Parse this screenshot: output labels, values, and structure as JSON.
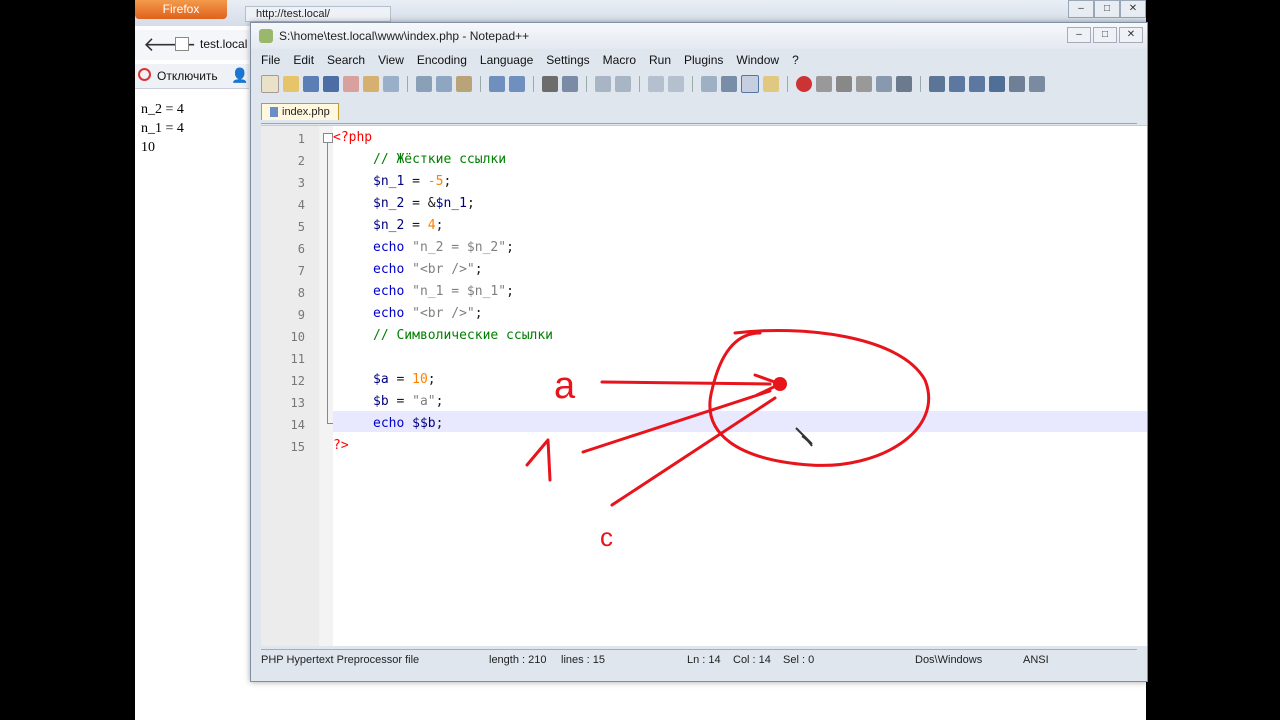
{
  "firefox": {
    "button_label": "Firefox",
    "tab_title": "http://test.local/",
    "site_label": "test.local",
    "disable_label": "Отключить",
    "output_lines": [
      "n_2 = 4",
      "n_1 = 4",
      "10"
    ]
  },
  "notepad": {
    "title": "S:\\home\\test.local\\www\\index.php - Notepad++",
    "menu": [
      "File",
      "Edit",
      "Search",
      "View",
      "Encoding",
      "Language",
      "Settings",
      "Macro",
      "Run",
      "Plugins",
      "Window",
      "?"
    ],
    "tab_label": "index.php",
    "lines": [
      {
        "n": "1"
      },
      {
        "n": "2"
      },
      {
        "n": "3"
      },
      {
        "n": "4"
      },
      {
        "n": "5"
      },
      {
        "n": "6"
      },
      {
        "n": "7"
      },
      {
        "n": "8"
      },
      {
        "n": "9"
      },
      {
        "n": "10"
      },
      {
        "n": "11"
      },
      {
        "n": "12"
      },
      {
        "n": "13"
      },
      {
        "n": "14"
      },
      {
        "n": "15"
      }
    ],
    "code": {
      "l1_tag": "<?php",
      "l2_comment": "// Жёсткие ссылки",
      "l3_var": "$n_1",
      "l3_op": " = ",
      "l3_num": "-5",
      "l3_end": ";",
      "l4_var": "$n_2",
      "l4_op": " = &",
      "l4_var2": "$n_1",
      "l4_end": ";",
      "l5_var": "$n_2",
      "l5_op": " = ",
      "l5_num": "4",
      "l5_end": ";",
      "l6_kw": "echo",
      "l6_str": " \"n_2 = $n_2\"",
      "l6_end": ";",
      "l7_kw": "echo",
      "l7_str": " \"<br />\"",
      "l7_end": ";",
      "l8_kw": "echo",
      "l8_str": " \"n_1 = $n_1\"",
      "l8_end": ";",
      "l9_kw": "echo",
      "l9_str": " \"<br />\"",
      "l9_end": ";",
      "l10_comment": "// Символические ссылки",
      "l12_var": "$a",
      "l12_op": " = ",
      "l12_num": "10",
      "l12_end": ";",
      "l13_var": "$b",
      "l13_op": " = ",
      "l13_str": "\"a\"",
      "l13_end": ";",
      "l14_kw": "echo",
      "l14_var": " $$b",
      "l14_end": ";",
      "l15_tag": "?>"
    },
    "status": {
      "file_type": "PHP Hypertext Preprocessor file",
      "length": "length : 210",
      "lines": "lines : 15",
      "ln": "Ln : 14",
      "col": "Col : 14",
      "sel": "Sel : 0",
      "eol": "Dos\\Windows",
      "encoding": "ANSI"
    }
  },
  "annotation_letters": {
    "a": "a",
    "one": "1",
    "c": "c"
  },
  "colors": {
    "annotation": "#e8141b",
    "current_line": "#e8e8ff",
    "firefox_orange": "#e0621c"
  }
}
